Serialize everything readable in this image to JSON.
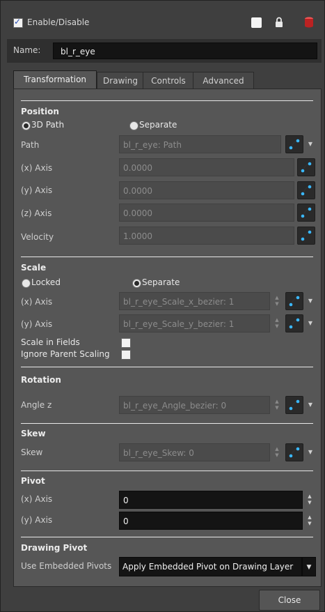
{
  "header": {
    "enable_label": "Enable/Disable",
    "enabled": true,
    "icons": [
      "white-square-icon",
      "lock-icon",
      "layer-color-icon"
    ]
  },
  "name": {
    "label": "Name:",
    "value": "bl_r_eye"
  },
  "tabs": [
    {
      "label": "Transformation",
      "active": true
    },
    {
      "label": "Drawing",
      "active": false
    },
    {
      "label": "Controls",
      "active": false
    },
    {
      "label": "Advanced",
      "active": false
    }
  ],
  "position": {
    "title": "Position",
    "radio_3d": "3D Path",
    "radio_sep": "Separate",
    "path_label": "Path",
    "path_value": "bl_r_eye: Path",
    "x_label": "(x) Axis",
    "x_value": "0.0000",
    "y_label": "(y) Axis",
    "y_value": "0.0000",
    "z_label": "(z) Axis",
    "z_value": "0.0000",
    "vel_label": "Velocity",
    "vel_value": "1.0000"
  },
  "scale": {
    "title": "Scale",
    "radio_locked": "Locked",
    "radio_sep": "Separate",
    "x_label": "(x) Axis",
    "x_value": "bl_r_eye_Scale_x_bezier: 1",
    "y_label": "(y) Axis",
    "y_value": "bl_r_eye_Scale_y_bezier: 1",
    "fields_label": "Scale in Fields",
    "ignore_label": "Ignore Parent Scaling"
  },
  "rotation": {
    "title": "Rotation",
    "angle_label": "Angle z",
    "angle_value": "bl_r_eye_Angle_bezier: 0"
  },
  "skew": {
    "title": "Skew",
    "label": "Skew",
    "value": "bl_r_eye_Skew: 0"
  },
  "pivot": {
    "title": "Pivot",
    "x_label": "(x) Axis",
    "x_value": "0",
    "y_label": "(y) Axis",
    "y_value": "0"
  },
  "drawing_pivot": {
    "title": "Drawing Pivot",
    "label": "Use Embedded Pivots",
    "value": "Apply Embedded Pivot on Drawing Layer"
  },
  "footer": {
    "close_label": "Close"
  }
}
